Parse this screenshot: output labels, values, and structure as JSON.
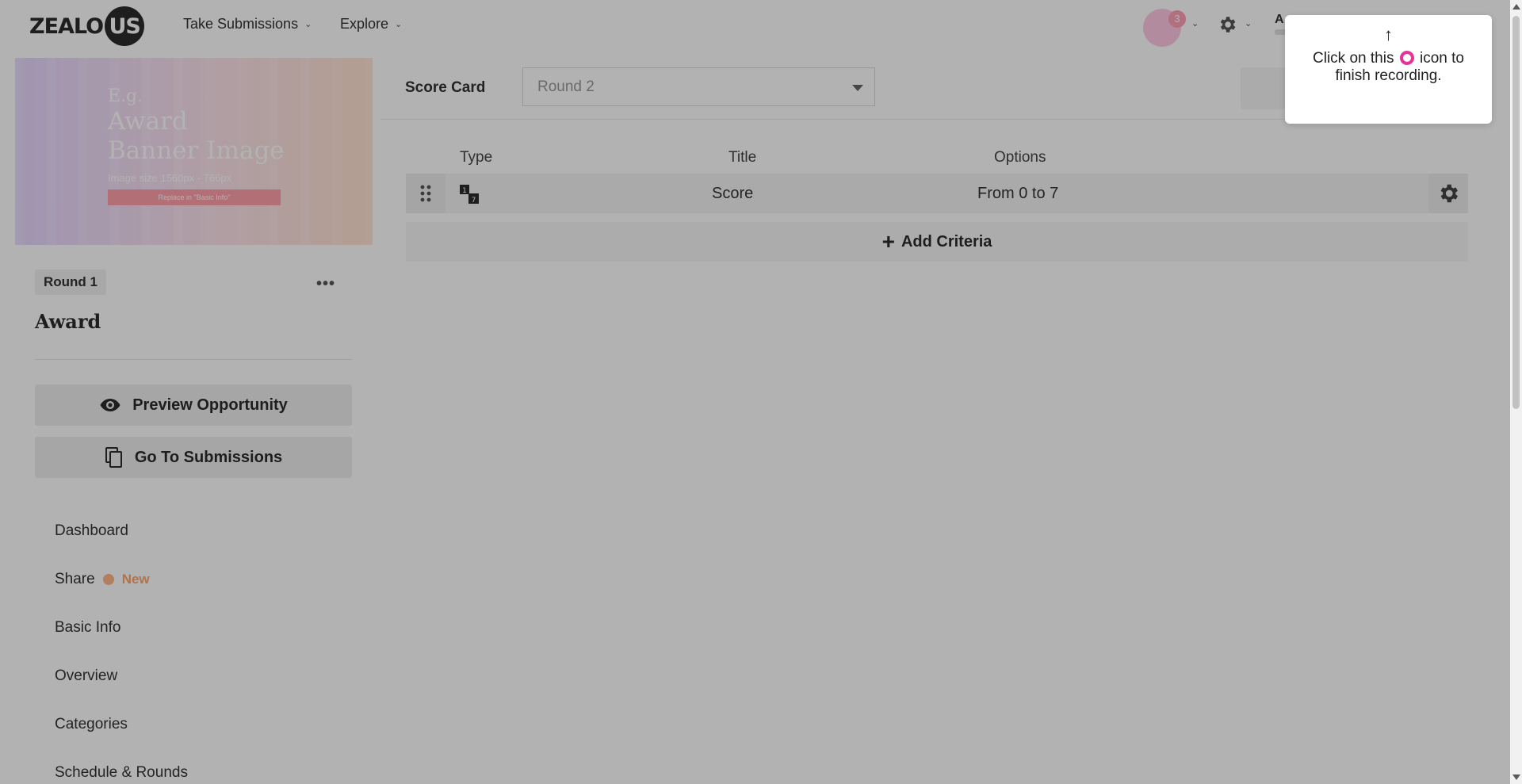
{
  "header": {
    "logo_text": "ZEALO",
    "logo_circle_text": "US",
    "nav": [
      {
        "label": "Take Submissions"
      },
      {
        "label": "Explore"
      }
    ],
    "recording_badge": "3",
    "user_initial": "A"
  },
  "left_panel": {
    "banner": {
      "eg": "E.g.",
      "line1": "Award",
      "line2": "Banner Image",
      "image_size": "Image size 1560px - 766px",
      "replace_hint": "Replace in \"Basic Info\""
    },
    "round_pill": "Round 1",
    "more_icon": "•••",
    "title": "Award",
    "preview_button": "Preview Opportunity",
    "submissions_button": "Go To Submissions"
  },
  "sidebar": {
    "items": [
      {
        "label": "Dashboard"
      },
      {
        "label": "Share",
        "badge": "New"
      },
      {
        "label": "Basic Info"
      },
      {
        "label": "Overview"
      },
      {
        "label": "Categories"
      },
      {
        "label": "Schedule & Rounds"
      }
    ]
  },
  "main": {
    "score_card_label": "Score Card",
    "round_select": {
      "value": "Round 2"
    },
    "columns": [
      "Type",
      "Title",
      "Options"
    ],
    "rows": [
      {
        "title": "Score",
        "options": "From 0 to 7"
      }
    ],
    "add_criteria": "Add Criteria"
  },
  "tooltip": {
    "arrow": "↑",
    "text_before": "Click on this",
    "text_after": "icon to finish recording."
  },
  "colors": {
    "accent_pink": "#e4349b",
    "new_badge": "#ffa46a"
  }
}
